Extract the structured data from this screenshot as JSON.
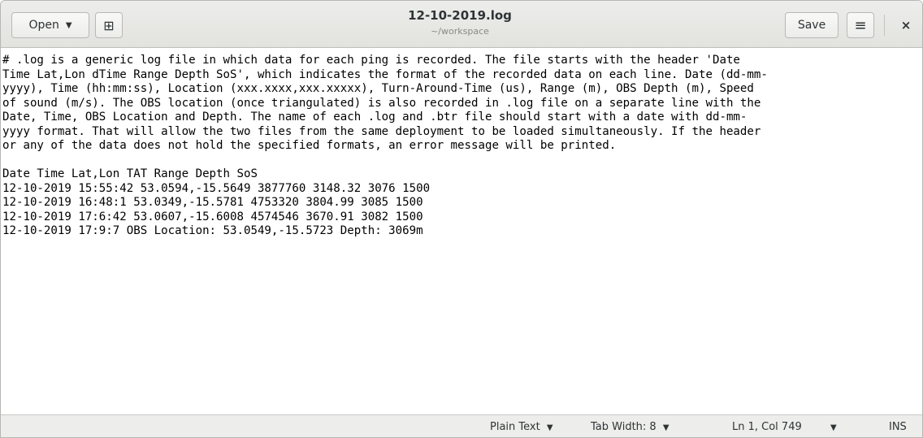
{
  "header": {
    "open_label": "Open",
    "open_caret": "▼",
    "newtab_icon": "⊞",
    "title": "12-10-2019.log",
    "subtitle": "~/workspace",
    "save_label": "Save",
    "menu_icon": "≡",
    "close_icon": "×"
  },
  "editor": {
    "lines": [
      "# .log is a generic log file in which data for each ping is recorded. The file starts with the header 'Date",
      "Time Lat,Lon dTime Range Depth SoS', which indicates the format of the recorded data on each line. Date (dd-mm-",
      "yyyy), Time (hh:mm:ss), Location (xxx.xxxx,xxx.xxxxx), Turn-Around-Time (us), Range (m), OBS Depth (m), Speed",
      "of sound (m/s). The OBS location (once triangulated) is also recorded in .log file on a separate line with the",
      "Date, Time, OBS Location and Depth. The name of each .log and .btr file should start with a date with dd-mm-",
      "yyyy format. That will allow the two files from the same deployment to be loaded simultaneously. If the header",
      "or any of the data does not hold the specified formats, an error message will be printed.",
      "",
      "Date Time Lat,Lon TAT Range Depth SoS",
      "12-10-2019 15:55:42 53.0594,-15.5649 3877760 3148.32 3076 1500",
      "12-10-2019 16:48:1 53.0349,-15.5781 4753320 3804.99 3085 1500",
      "12-10-2019 17:6:42 53.0607,-15.6008 4574546 3670.91 3082 1500",
      "12-10-2019 17:9:7 OBS Location: 53.0549,-15.5723 Depth: 3069m"
    ]
  },
  "statusbar": {
    "language": "Plain Text",
    "tab_width": "Tab Width: 8",
    "cursor_position": "Ln 1, Col 749",
    "insert_mode": "INS",
    "caret": "▼"
  }
}
